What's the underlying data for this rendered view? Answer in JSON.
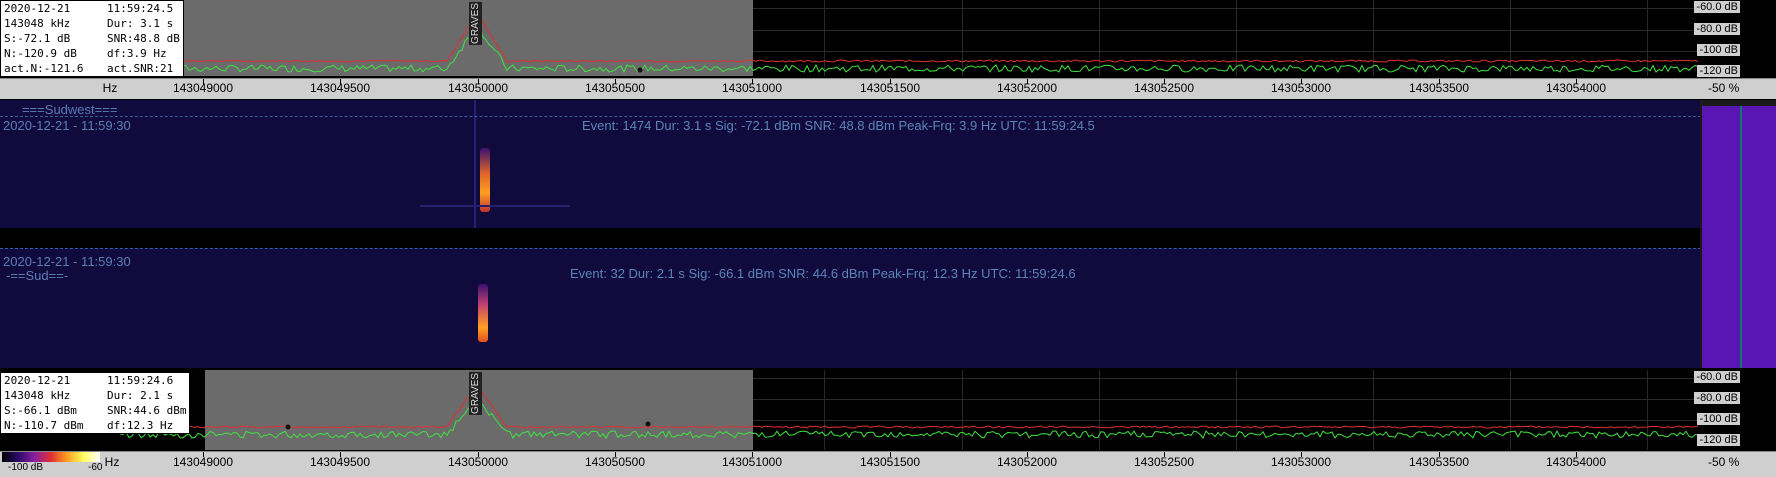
{
  "top": {
    "info": {
      "date": "2020-12-21",
      "time": "11:59:24.5",
      "freq": "143048 kHz",
      "dur": "Dur: 3.1 s",
      "sig": "S:-72.1 dB",
      "snr": "SNR:48.8 dB",
      "noise": "N:-120.9 dB",
      "df": "df:3.9 Hz",
      "actn": "act.N:-121.6",
      "actsnr": "act.SNR:21"
    },
    "tag": "GRAVES",
    "db_labels": [
      "-60.0 dB",
      "-80.0 dB",
      "-100 dB",
      "-120 dB"
    ]
  },
  "scale_top": {
    "unit": "Hz",
    "freqs": [
      "143049000",
      "143049500",
      "143050000",
      "143050500",
      "143051000",
      "143051500",
      "143052000",
      "143052500",
      "143053000",
      "143053500",
      "143054000"
    ],
    "pct": "-50 %"
  },
  "waterfall1": {
    "stamp": "2020-12-21 - 11:59:30",
    "station": "===Sudwest===",
    "event": "Event: 1474   Dur: 3.1 s   Sig: -72.1 dBm   SNR: 48.8 dBm   Peak-Frq: 3.9 Hz   UTC: 11:59:24.5"
  },
  "waterfall2": {
    "stamp": "2020-12-21 - 11:59:30",
    "station": "-==Sud==-",
    "event": "Event: 32   Dur: 2.1 s   Sig: -66.1 dBm   SNR: 44.6 dBm   Peak-Frq: 12.3 Hz   UTC: 11:59:24.6"
  },
  "bottom": {
    "info": {
      "date": "2020-12-21",
      "time": "11:59:24.6",
      "freq": "143048 kHz",
      "dur": "Dur: 2.1 s",
      "sig": "S:-66.1 dBm",
      "snr": "SNR:44.6 dBm",
      "noise": "N:-110.7 dBm",
      "df": "df:12.3 Hz"
    },
    "tag": "GRAVES",
    "db_labels": [
      "-60.0 dB",
      "-80.0 dB",
      "-100 dB",
      "-120 dB"
    ],
    "colorbar_labels": [
      "-100 dB",
      "-60"
    ]
  },
  "scale_bottom": {
    "unit": "Hz",
    "freqs": [
      "143049000",
      "143049500",
      "143050000",
      "143050500",
      "143051000",
      "143051500",
      "143052000",
      "143052500",
      "143053000",
      "143053500",
      "143054000"
    ],
    "pct": "-50 %"
  },
  "colors": {
    "noise_trace": "#3fe33f",
    "peak_trace": "#e03030",
    "waterfall_bg": "#110a3d",
    "gray_band": "#6b6b6b"
  }
}
